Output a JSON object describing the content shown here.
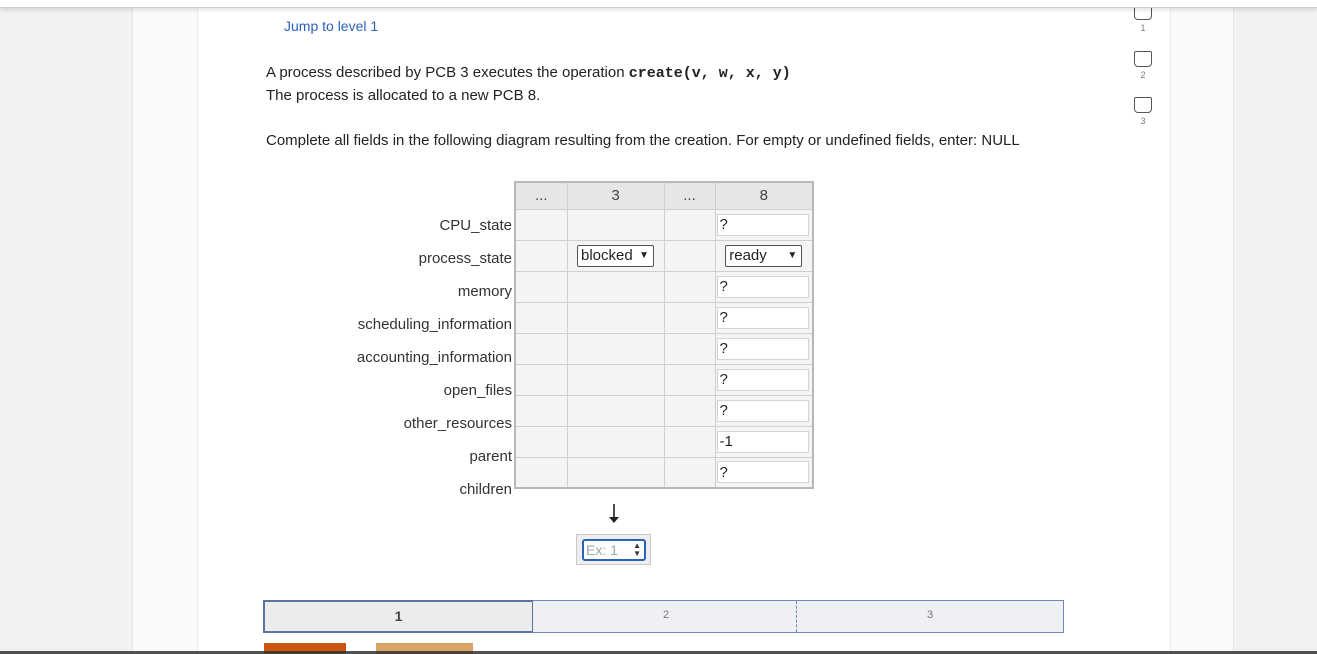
{
  "jump_link": "Jump to level 1",
  "prompt": {
    "line1_prefix": "A process described by PCB 3 executes the operation ",
    "operation": "create(v, w, x, y)",
    "line2": "The process is allocated to a new PCB 8.",
    "line3": "Complete all fields in the following diagram resulting from the creation. For empty or undefined fields, enter: NULL"
  },
  "table": {
    "columns": [
      "...",
      "3",
      "...",
      "8"
    ],
    "rows": [
      "CPU_state",
      "process_state",
      "memory",
      "scheduling_information",
      "accounting_information",
      "open_files",
      "other_resources",
      "parent",
      "children"
    ],
    "pcb3_process_state": "blocked",
    "pcb8_process_state": "ready",
    "pcb8_values": {
      "CPU_state": "?",
      "memory": "?",
      "scheduling_information": "?",
      "accounting_information": "?",
      "open_files": "?",
      "other_resources": "?",
      "parent": "-1",
      "children": "?"
    }
  },
  "children_input": {
    "placeholder": "Ex: 1"
  },
  "levels": [
    {
      "label": "1",
      "current": true
    },
    {
      "label": "2",
      "current": false
    },
    {
      "label": "3",
      "current": false
    }
  ],
  "side_levels": [
    "1",
    "2",
    "3"
  ]
}
